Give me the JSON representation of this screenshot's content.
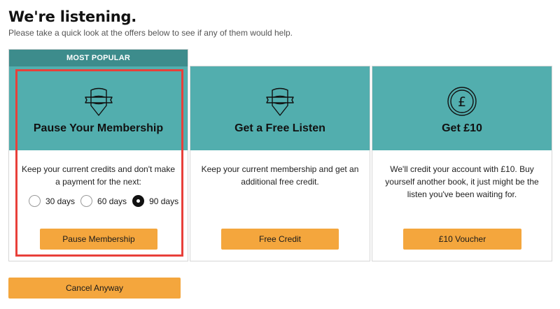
{
  "header": {
    "title": "We're listening.",
    "subtitle": "Please take a quick look at the offers below to see if any of them would help."
  },
  "offers": [
    {
      "id": "pause",
      "banner": "MOST POPULAR",
      "icon": "shield-ribbon-icon",
      "title": "Pause Your Membership",
      "description": "Keep your current credits and don't make a payment for the next:",
      "options": [
        {
          "label": "30 days",
          "selected": false
        },
        {
          "label": "60 days",
          "selected": false
        },
        {
          "label": "90 days",
          "selected": true
        }
      ],
      "button_label": "Pause Membership"
    },
    {
      "id": "free",
      "icon": "shield-ribbon-icon",
      "title": "Get a Free Listen",
      "description": "Keep your current membership and get an additional free credit.",
      "button_label": "Free Credit"
    },
    {
      "id": "voucher",
      "icon": "pound-coin-icon",
      "title": "Get £10",
      "description": "We'll credit your account with £10. Buy yourself another book, it just might be the listen you've been waiting for.",
      "button_label": "£10 Voucher"
    }
  ],
  "footer": {
    "cancel_label": "Cancel Anyway"
  },
  "colors": {
    "teal": "#52aeae",
    "banner_teal": "#3d8c8c",
    "orange": "#f4a63d",
    "highlight_red": "#e8403a"
  }
}
